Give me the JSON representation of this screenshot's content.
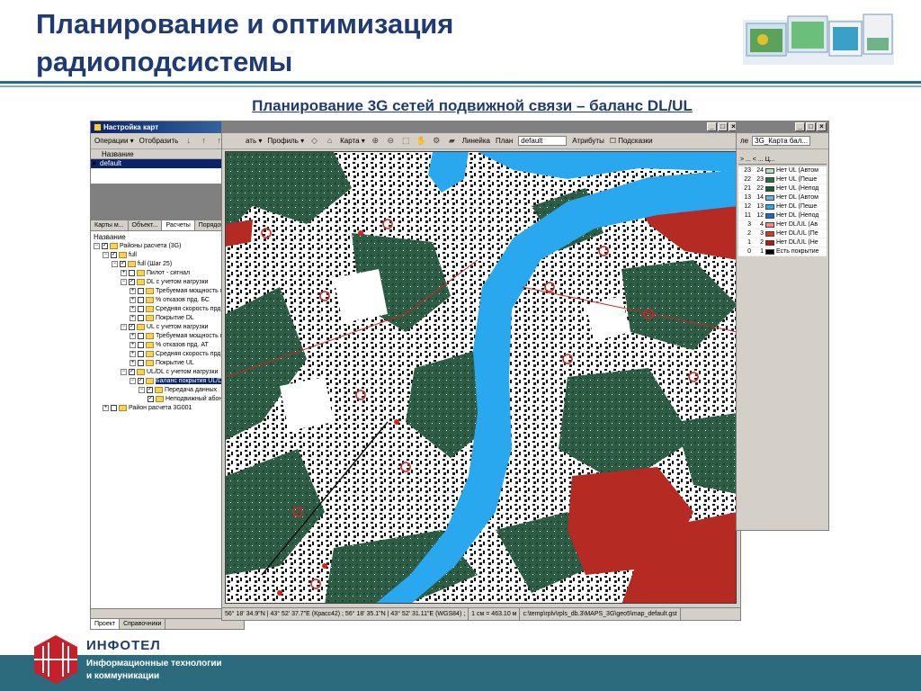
{
  "slide": {
    "title_line1": "Планирование и оптимизация",
    "title_line2": "радиоподсистемы",
    "subtitle": "Планирование 3G сетей подвижной связи – баланс DL/UL"
  },
  "left_window": {
    "title": "Настройка карт",
    "toolbar": {
      "operations": "Операции ▾",
      "display": "Отобразить"
    },
    "list_header": "Название",
    "list_selected": "default",
    "tabs": [
      "Карты м...",
      "Объект...",
      "Расчеты",
      "Порядок..."
    ],
    "active_tab": "Расчеты",
    "tree_caption": "Название",
    "tree": [
      {
        "indent": 0,
        "exp": "−",
        "cb": "✓",
        "label": "Районы расчета (3G)"
      },
      {
        "indent": 1,
        "exp": "−",
        "cb": "✓",
        "label": "full"
      },
      {
        "indent": 2,
        "exp": "−",
        "cb": "✓",
        "label": "full (Шаг 25)"
      },
      {
        "indent": 3,
        "exp": "+",
        "cb": "",
        "label": "Пилот - сигнал"
      },
      {
        "indent": 3,
        "exp": "−",
        "cb": "✓",
        "label": "DL с учетом нагрузки"
      },
      {
        "indent": 4,
        "exp": "+",
        "cb": "",
        "label": "Требуемая мощность прд. Б"
      },
      {
        "indent": 4,
        "exp": "+",
        "cb": "",
        "label": "% отказов прд. БС"
      },
      {
        "indent": 4,
        "exp": "+",
        "cb": "",
        "label": "Средняя скорость прд. БС"
      },
      {
        "indent": 4,
        "exp": "+",
        "cb": "",
        "label": "Покрытие DL"
      },
      {
        "indent": 3,
        "exp": "−",
        "cb": "✓",
        "label": "UL с учетом нагрузки"
      },
      {
        "indent": 4,
        "exp": "+",
        "cb": "",
        "label": "Требуемая мощность прд. А"
      },
      {
        "indent": 4,
        "exp": "+",
        "cb": "",
        "label": "% отказов прд. АТ"
      },
      {
        "indent": 4,
        "exp": "+",
        "cb": "",
        "label": "Средняя скорость прд. АТ"
      },
      {
        "indent": 4,
        "exp": "+",
        "cb": "",
        "label": "Покрытие UL"
      },
      {
        "indent": 3,
        "exp": "−",
        "cb": "✓",
        "label": "UL/DL с учетом нагрузки"
      },
      {
        "indent": 4,
        "exp": "−",
        "cb": "✓",
        "label": "Баланс покрытия UL/DL",
        "highlight": true
      },
      {
        "indent": 5,
        "exp": "−",
        "cb": "✓",
        "label": "Передача данных"
      },
      {
        "indent": 6,
        "exp": "",
        "cb": "✓",
        "label": "Неподвижный абонент"
      },
      {
        "indent": 1,
        "exp": "+",
        "cb": "",
        "label": "Район расчета 3G001"
      }
    ],
    "bottom_tabs": [
      "Проект",
      "Справочники"
    ]
  },
  "map_window": {
    "toolbar": {
      "item1": "ать ▾",
      "profile": "Профиль ▾",
      "map": "Карта ▾",
      "ruler": "Линейка",
      "plan": "План",
      "layer_value": "default",
      "attributes": "Атрибуты",
      "hints": "Подсказки"
    },
    "status": {
      "coords": "56° 18' 34.9\"N  |  43° 52' 37.7\"E (Красс42) ; 56° 18' 35.1\"N  |  43° 52' 31.11\"E (WGS84) ;",
      "scale": "1 см = 463.10 м",
      "path": "c:\\temp\\rplv\\rpls_db.3\\MAPS_3G\\geo5\\map_default.gst"
    }
  },
  "right_window": {
    "tab_label": "ле",
    "tab_value": "3G_Карта бал...",
    "col_headers": "> ... < ... Ц...",
    "rows": [
      {
        "a": "23",
        "b": "24",
        "color": "#b9dcc8",
        "label": "Нет UL  (Автом"
      },
      {
        "a": "22",
        "b": "23",
        "color": "#2e6b4a",
        "label": "Нет UL  (Пеше"
      },
      {
        "a": "21",
        "b": "22",
        "color": "#1d5a3a",
        "label": "Нет UL  (Непод"
      },
      {
        "a": "13",
        "b": "14",
        "color": "#6fb3e0",
        "label": "Нет DL  (Автом"
      },
      {
        "a": "12",
        "b": "13",
        "color": "#2ea8e8",
        "label": "Нет DL  (Пеше"
      },
      {
        "a": "11",
        "b": "12",
        "color": "#1570c0",
        "label": "Нет DL  (Непод"
      },
      {
        "a": "3",
        "b": "4",
        "color": "#f08a80",
        "label": "Нет DL/UL (Ав"
      },
      {
        "a": "2",
        "b": "3",
        "color": "#d03a30",
        "label": "Нет DL/UL (Пе"
      },
      {
        "a": "1",
        "b": "2",
        "color": "#b01c14",
        "label": "Нет DL/UL (Не"
      },
      {
        "a": "0",
        "b": "1",
        "color": "#000000",
        "label": "Есть покрытие"
      }
    ]
  },
  "footer": {
    "brand": "ИНФОТЕЛ",
    "tagline1": "Информационные технологии",
    "tagline2": "и коммуникации"
  },
  "colors": {
    "title": "#1f3b73",
    "footer": "#2c6b7e",
    "map_water": "#29a8ef",
    "map_forest": "#2e5d45",
    "map_red": "#b52a22"
  }
}
